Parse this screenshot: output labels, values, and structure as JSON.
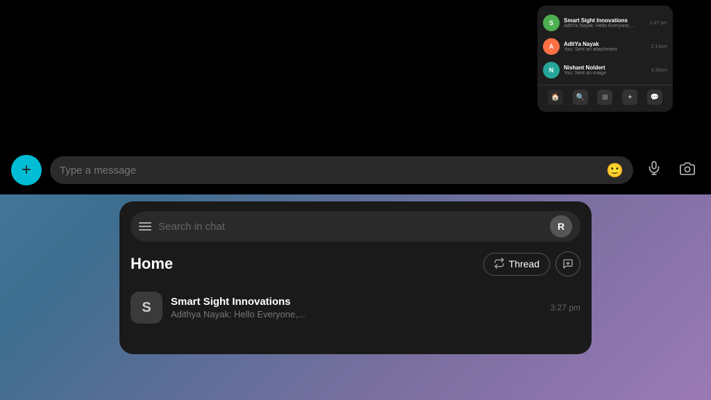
{
  "top_section": {
    "mini_chat": {
      "items": [
        {
          "name": "Smart Sight Innovations",
          "preview": "AdItYa Nayak: Hello Everyone,...",
          "time": "1:47 pm",
          "avatar_letter": "S",
          "avatar_color": "green"
        },
        {
          "name": "AdItYa Nayak",
          "preview": "You: Sent an attachment",
          "time": "2:14pm",
          "avatar_letter": "A",
          "avatar_color": "orange"
        },
        {
          "name": "Nishant Noldert",
          "preview": "You: Sent an image",
          "time": "3:30pm",
          "avatar_letter": "N",
          "avatar_color": "teal"
        }
      ],
      "bottom_icons": [
        "🏠",
        "🔍",
        "📷",
        "✨",
        "💬"
      ]
    }
  },
  "message_bar": {
    "placeholder": "Type a message",
    "plus_label": "+",
    "emoji_symbol": "🙂",
    "mic_symbol": "🎤",
    "camera_symbol": "📷"
  },
  "bottom_section": {
    "search_placeholder": "Search in chat",
    "avatar_label": "R",
    "home_title": "Home",
    "thread_button_label": "Thread",
    "new_chat_symbol": "✏️",
    "chat_items": [
      {
        "name": "Smart Sight Innovations",
        "preview": "Adithya Nayak: Hello Everyone,...",
        "time": "3:27 pm",
        "avatar_letter": "S"
      }
    ]
  }
}
